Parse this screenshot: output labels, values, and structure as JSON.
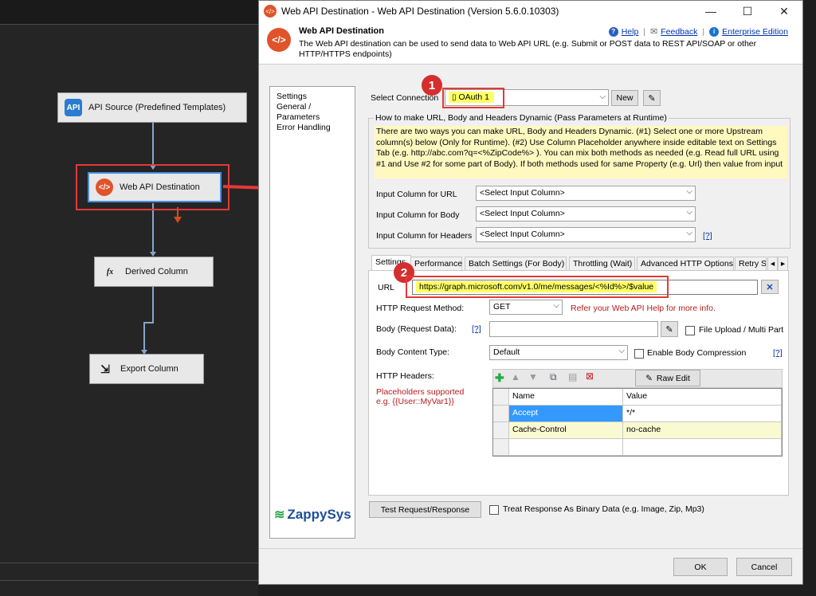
{
  "canvas": {
    "tasks": [
      {
        "label": "API Source (Predefined Templates)",
        "icon": "API"
      },
      {
        "label": "Web API Destination",
        "icon": "</>"
      },
      {
        "label": "Derived Column",
        "icon": "fx"
      },
      {
        "label": "Export Column",
        "icon": "⇲"
      }
    ]
  },
  "dialog": {
    "title": "Web API Destination - Web API Destination (Version 5.6.0.10303)",
    "header_title": "Web API Destination",
    "header_desc": "The Web API destination can be used to send data to Web API URL (e.g. Submit or POST data to REST API/SOAP or other HTTP/HTTPS endpoints)",
    "links": {
      "help": "Help",
      "feedback": "Feedback",
      "edition": "Enterprise Edition"
    },
    "sidebar": [
      "Settings",
      "General / Parameters",
      "Error Handling"
    ],
    "logo": "ZappySys"
  },
  "connection": {
    "label": "Select Connection",
    "value": "OAuth 1",
    "new_label": "New"
  },
  "dynamic": {
    "title": "How to make URL, Body and Headers Dynamic (Pass Parameters at Runtime)",
    "text": "There are two ways you can make URL, Body and Headers Dynamic. (#1) Select one or more Upstream column(s) below (Only for Runtime). (#2) Use Column Placeholder anywhere inside editable text on Settings Tab (e.g. http://abc.com?q=<%ZipCode%> ). You can mix both methods as needed (e.g. Read full URL using #1 and Use #2 for some part of Body). If both methods used for same Property (e.g. Url) then value from input",
    "url_label": "Input Column for URL",
    "body_label": "Input Column for Body",
    "headers_label": "Input Column for Headers",
    "select_placeholder": "<Select Input Column>",
    "help_link": "[?]"
  },
  "tabs": [
    "Settings",
    "Performance",
    "Batch Settings (For Body)",
    "Throttling (Wait)",
    "Advanced HTTP Options",
    "Retry S"
  ],
  "settings": {
    "url_label": "URL",
    "url_value": "https://graph.microsoft.com/v1.0/me/messages/<%Id%>/$value",
    "method_label": "HTTP Request Method:",
    "method_value": "GET",
    "method_hint": "Refer your Web API Help for more info.",
    "body_label": "Body (Request Data):",
    "body_help": "[?]",
    "file_upload": "File Upload / Multi Part",
    "content_type_label": "Body Content Type:",
    "content_type_value": "Default",
    "compression": "Enable Body Compression",
    "compression_help": "[?]",
    "headers_label": "HTTP Headers:",
    "placeholders_note_1": "Placeholders supported",
    "placeholders_note_2": "e.g. {{User::MyVar1}}",
    "raw_edit": "Raw Edit",
    "grid_columns": [
      "Name",
      "Value"
    ],
    "grid_rows": [
      {
        "name": "Accept",
        "value": "*/*"
      },
      {
        "name": "Cache-Control",
        "value": "no-cache"
      }
    ]
  },
  "bottom": {
    "test_button": "Test Request/Response",
    "binary_label": "Treat Response As Binary Data (e.g. Image, Zip, Mp3)",
    "ok": "OK",
    "cancel": "Cancel"
  },
  "annotations": {
    "badge1": "1",
    "badge2": "2"
  },
  "colors": {
    "accent": "#e53935",
    "highlight": "#ffff66",
    "info_bg": "#fff9c0",
    "selected_row": "#3399ff"
  }
}
